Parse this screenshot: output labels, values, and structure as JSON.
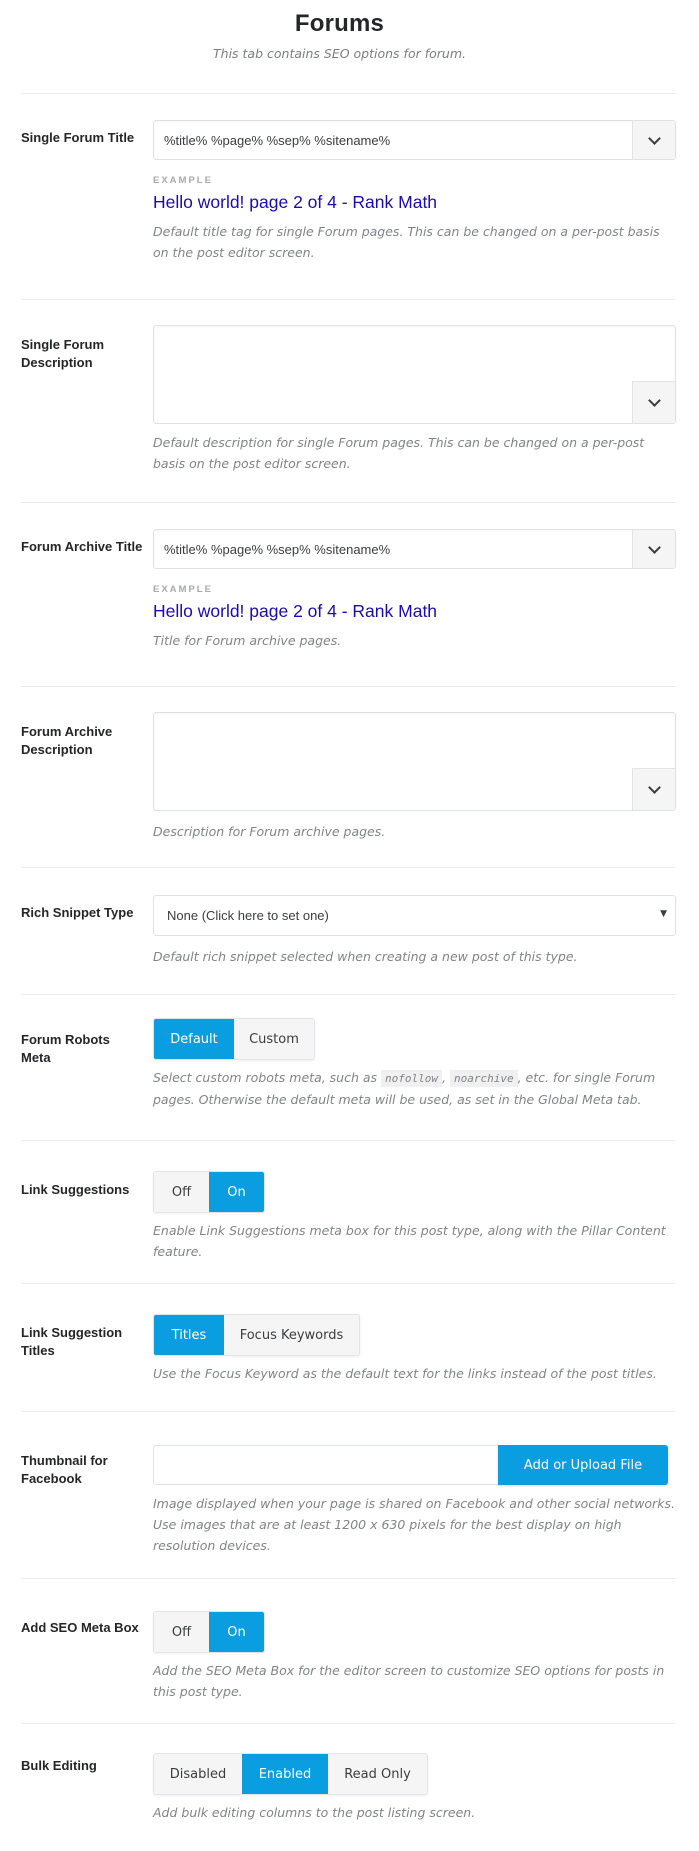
{
  "header": {
    "title": "Forums",
    "subtitle": "This tab contains SEO options for forum."
  },
  "colors": {
    "accent": "#0a9de0",
    "example_link": "#1a0dab"
  },
  "single_title": {
    "label": "Single Forum Title",
    "value": "%title% %page% %sep% %sitename%",
    "example_label": "EXAMPLE",
    "example_text": "Hello world! page 2 of 4 - Rank Math",
    "desc": "Default title tag for single Forum pages. This can be changed on a per-post basis on the post editor screen.",
    "vars_icon": "chevron-down-icon"
  },
  "single_desc": {
    "label": "Single Forum Description",
    "value": "",
    "desc": "Default description for single Forum pages. This can be changed on a per-post basis on the post editor screen."
  },
  "archive_title": {
    "label": "Forum Archive Title",
    "value": "%title% %page% %sep% %sitename%",
    "example_label": "EXAMPLE",
    "example_text": "Hello world! page 2 of 4 - Rank Math",
    "desc": "Title for Forum archive pages."
  },
  "archive_desc": {
    "label": "Forum Archive Description",
    "value": "",
    "desc": "Description for Forum archive pages."
  },
  "rich_snippet": {
    "label": "Rich Snippet Type",
    "selected": "None (Click here to set one)",
    "caret": "▼",
    "desc": "Default rich snippet selected when creating a new post of this type."
  },
  "robots_meta": {
    "label": "Forum Robots Meta",
    "options": [
      "Default",
      "Custom"
    ],
    "selected": "Default",
    "desc_prefix": "Select custom robots meta, such as ",
    "code1": "nofollow",
    "sep": ", ",
    "code2": "noarchive",
    "desc_suffix": ", etc. for single Forum pages. Otherwise the default meta will be used, as set in the Global Meta tab."
  },
  "link_suggestions": {
    "label": "Link Suggestions",
    "options": [
      "Off",
      "On"
    ],
    "selected": "On",
    "desc": "Enable Link Suggestions meta box for this post type, along with the Pillar Content feature."
  },
  "link_suggestion_titles": {
    "label": "Link Suggestion Titles",
    "options": [
      "Titles",
      "Focus Keywords"
    ],
    "selected": "Titles",
    "desc": "Use the Focus Keyword as the default text for the links instead of the post titles."
  },
  "thumbnail": {
    "label": "Thumbnail for Facebook",
    "value": "",
    "button": "Add or Upload File",
    "desc": "Image displayed when your page is shared on Facebook and other social networks. Use images that are at least 1200 x 630 pixels for the best display on high resolution devices."
  },
  "seo_meta_box": {
    "label": "Add SEO Meta Box",
    "options": [
      "Off",
      "On"
    ],
    "selected": "On",
    "desc": "Add the SEO Meta Box for the editor screen to customize SEO options for posts in this post type."
  },
  "bulk_editing": {
    "label": "Bulk Editing",
    "options": [
      "Disabled",
      "Enabled",
      "Read Only"
    ],
    "selected": "Enabled",
    "desc": "Add bulk editing columns to the post listing screen."
  }
}
